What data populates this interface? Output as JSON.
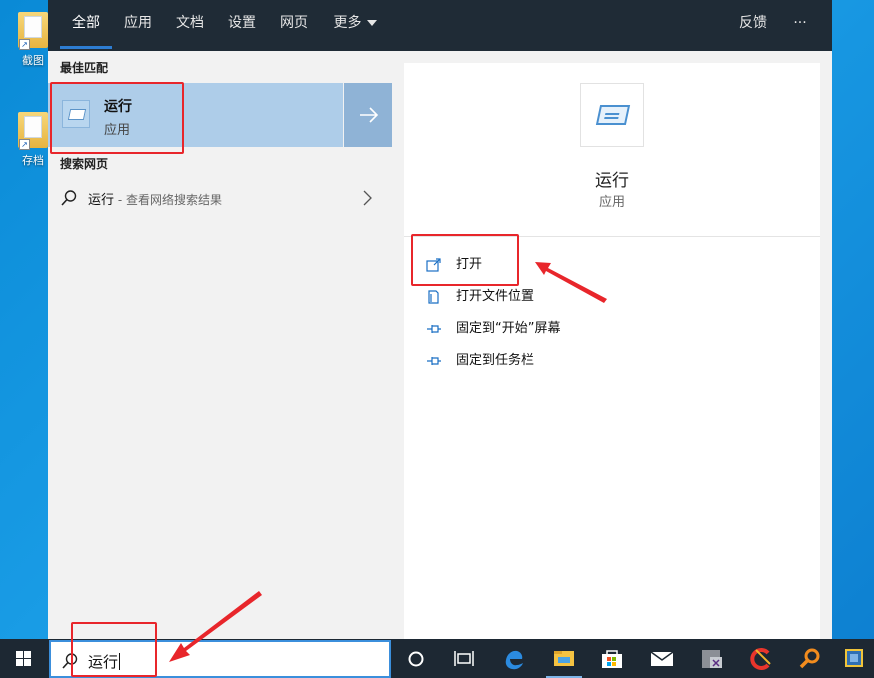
{
  "desktop": {
    "icons": [
      {
        "label": "截图"
      },
      {
        "label": "存档"
      }
    ]
  },
  "search_panel": {
    "tabs": [
      {
        "label": "全部",
        "active": true
      },
      {
        "label": "应用"
      },
      {
        "label": "文档"
      },
      {
        "label": "设置"
      },
      {
        "label": "网页"
      },
      {
        "label": "更多"
      }
    ],
    "feedback_label": "反馈",
    "more_options_label": "···",
    "best_match_heading": "最佳匹配",
    "best_match": {
      "title": "运行",
      "subtitle": "应用"
    },
    "web_heading": "搜索网页",
    "web_item": {
      "query": "运行",
      "separator": " - ",
      "hint": "查看网络搜索结果"
    },
    "detail": {
      "title": "运行",
      "subtitle": "应用",
      "actions": [
        {
          "label": "打开",
          "icon": "open-icon"
        },
        {
          "label": "打开文件位置",
          "icon": "file-location-icon"
        },
        {
          "label": "固定到“开始”屏幕",
          "icon": "pin-icon"
        },
        {
          "label": "固定到任务栏",
          "icon": "pin-icon"
        }
      ]
    }
  },
  "taskbar": {
    "search_value": "运行",
    "items": [
      "cortana-icon",
      "task-view-icon",
      "edge-icon",
      "file-explorer-icon",
      "store-icon",
      "mail-icon",
      "app-icon",
      "ccleaner-icon",
      "search-tool-icon",
      "virtualbox-icon"
    ]
  },
  "colors": {
    "accent": "#2d7dd2",
    "best_match_bg": "#aecde9",
    "annotation_red": "#e8262b",
    "taskbar_bg": "#1d2833"
  }
}
